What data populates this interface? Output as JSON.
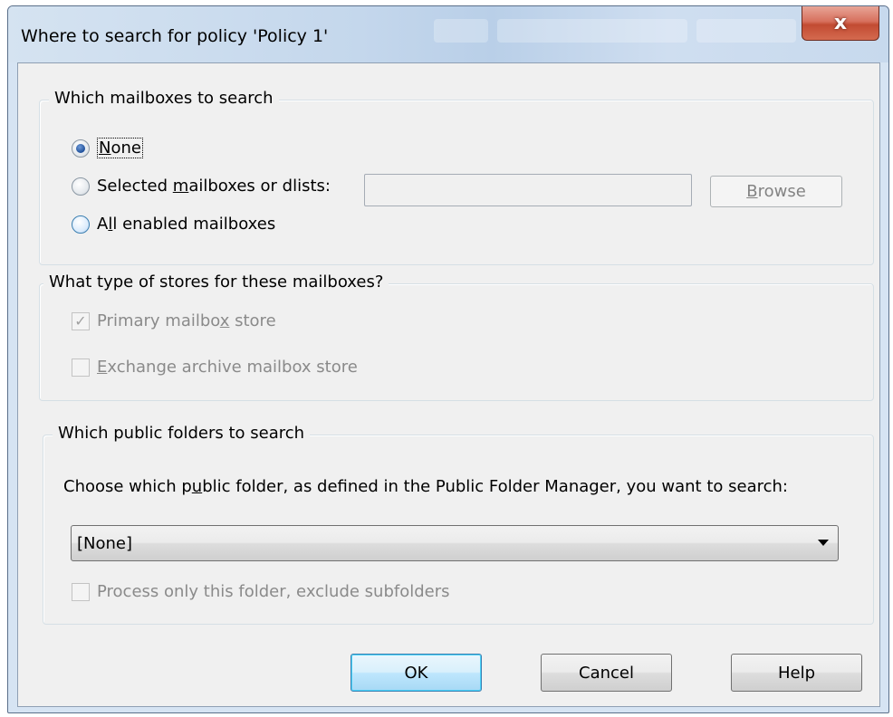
{
  "window": {
    "title": "Where to search for policy 'Policy 1'",
    "close_glyph": "x"
  },
  "mailboxes": {
    "group_title": "Which mailboxes to search",
    "options": [
      {
        "label_pre": "",
        "mnemonic": "N",
        "label_post": "one",
        "checked": true
      },
      {
        "label_pre": "Selected ",
        "mnemonic": "m",
        "label_post": "ailboxes or dlists:",
        "checked": false
      },
      {
        "label_pre": "A",
        "mnemonic": "l",
        "label_post": "l enabled mailboxes",
        "checked": false
      }
    ],
    "selected_value": "",
    "browse_pre": "",
    "browse_mnemonic": "B",
    "browse_post": "rowse"
  },
  "stores": {
    "group_title": "What type of stores for these mailboxes?",
    "primary": {
      "label_pre": "Primary mailbo",
      "mnemonic": "x",
      "label_post": " store",
      "checked": true
    },
    "archive": {
      "label_pre": "",
      "mnemonic": "E",
      "label_post": "xchange archive mailbox store",
      "checked": false
    }
  },
  "public_folders": {
    "group_title": "Which public folders to search",
    "prompt_pre": "Choose which p",
    "prompt_mnemonic": "u",
    "prompt_post": "blic folder, as defined in the Public Folder Manager, you want to search:",
    "selected": "[None]",
    "exclude_sub": {
      "label": "Process only this folder, exclude subfolders",
      "checked": false
    }
  },
  "footer": {
    "ok_label": "OK",
    "cancel_label": "Cancel",
    "help_label": "Help"
  },
  "icons": {
    "check_glyph": "✓"
  }
}
